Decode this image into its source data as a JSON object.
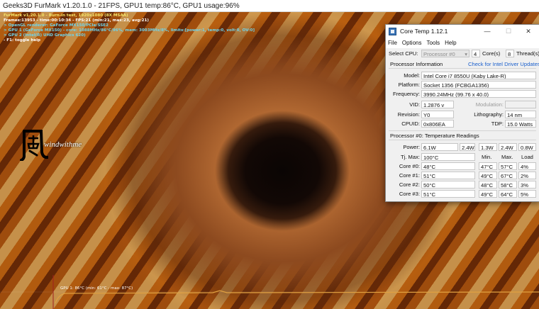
{
  "furmark": {
    "window_title": "Geeks3D FurMark v1.20.1.0 - 21FPS, GPU1 temp:86°C, GPU1 usage:96%",
    "hud_lines": [
      {
        "text": "FurMark v1.20.1.0 - Burn-in test, 1920x1080 (8X MSAA)",
        "color": "y"
      },
      {
        "text": "Frames:13953 - time:00:10:34 - FPS:21 (min:21, max:23, avg:21)",
        "color": "w"
      },
      {
        "text": "> OpenGL renderer: GeForce MX150/PCIe/SSE2",
        "color": "c"
      },
      {
        "text": "> GPU 1 (GeForce MX150) - core: 1088MHz/86°C/96%, mem: 3003MHz/8%, limits:[power:1, temp:0, volt:0, OV:0]",
        "color": "c"
      },
      {
        "text": "> GPU 2 (Intel(R) UHD Graphics 620)",
        "color": "c"
      },
      {
        "text": "- F1: toggle help",
        "color": "w"
      }
    ],
    "logo_text": "windwithme",
    "graph_label": "GPU 1: 86°C (min: 61°C - max: 87°C)"
  },
  "coretemp": {
    "title": "Core Temp 1.12.1",
    "window_controls": {
      "minimize": "—",
      "maximize": "☐",
      "close": "✕"
    },
    "menu": [
      "File",
      "Options",
      "Tools",
      "Help"
    ],
    "select_cpu_label": "Select CPU:",
    "select_cpu_value": "Processor #0",
    "cores_count": "4",
    "cores_label": "Core(s)",
    "threads_count": "8",
    "threads_label": "Thread(s)",
    "processor_info_label": "Processor Information",
    "driver_link": "Check for Intel Driver Updates",
    "model_label": "Model:",
    "model_value": "Intel Core i7 8550U (Kaby Lake-R)",
    "platform_label": "Platform:",
    "platform_value": "Socket 1356 (FCBGA1356)",
    "frequency_label": "Frequency:",
    "frequency_value": "3990.24MHz (99.76 x 40.0)",
    "vid_label": "VID:",
    "vid_value": "1.2876 v",
    "modulation_label": "Modulation:",
    "modulation_value": "",
    "revision_label": "Revision:",
    "revision_value": "Y0",
    "lithography_label": "Lithography:",
    "lithography_value": "14 nm",
    "cpuid_label": "CPUID:",
    "cpuid_value": "0x806EA",
    "tdp_label": "TDP:",
    "tdp_value": "15.0 Watts",
    "temps_section_label": "Processor #0: Temperature Readings",
    "power_label": "Power:",
    "power_values": [
      "6.1W",
      "2.4W",
      "1.3W",
      "2.4W",
      "0.8W"
    ],
    "tjmax_label": "Tj. Max:",
    "tjmax_value": "100°C",
    "col_min": "Min.",
    "col_max": "Max.",
    "col_load": "Load",
    "cores": [
      {
        "label": "Core #0:",
        "temp": "48°C",
        "min": "47°C",
        "max": "57°C",
        "load": "4%"
      },
      {
        "label": "Core #1:",
        "temp": "51°C",
        "min": "49°C",
        "max": "67°C",
        "load": "2%"
      },
      {
        "label": "Core #2:",
        "temp": "50°C",
        "min": "48°C",
        "max": "58°C",
        "load": "3%"
      },
      {
        "label": "Core #3:",
        "temp": "51°C",
        "min": "49°C",
        "max": "64°C",
        "load": "5%"
      }
    ]
  },
  "colors": {
    "hud_yellow": "#f4e46a",
    "hud_cyan": "#6fd3ea",
    "link_blue": "#1a5fcc",
    "graph_line": "#e0a040"
  }
}
